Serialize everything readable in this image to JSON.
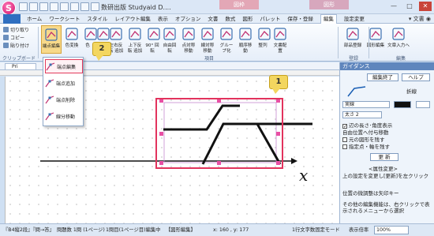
{
  "window": {
    "title": "数研出版 Studyaid D....",
    "context_tab_zoom": "図枠",
    "context_tab_figure": "図形",
    "app_icon": "S"
  },
  "menu": {
    "file": "",
    "items": [
      "ホーム",
      "ワークシート",
      "スタイル",
      "レイアウト編集",
      "表示",
      "オプション",
      "文書",
      "数式",
      "図形",
      "パレット",
      "保存・登録",
      "編集",
      "設定変更"
    ],
    "active_index": 11,
    "user": "文書"
  },
  "ribbon": {
    "clipboard": {
      "cut": "切り取り",
      "copy": "コピー",
      "paste": "貼り付け",
      "label": "クリップボード"
    },
    "buttons": [
      {
        "label": "端点編集",
        "selected": true
      },
      {
        "label": "色変換"
      },
      {
        "label": "色"
      },
      {
        "label": "縮小"
      },
      {
        "label": "左右反転 追加"
      },
      {
        "label": "上下反転 追加"
      },
      {
        "label": "90° 回転"
      },
      {
        "label": "自由回転"
      },
      {
        "label": "点対称 移動"
      },
      {
        "label": "線対称 移動"
      },
      {
        "label": "グループ化"
      },
      {
        "label": "順序移動"
      },
      {
        "label": "整列"
      },
      {
        "label": "文書配置"
      },
      {
        "label": "部品登録"
      },
      {
        "label": "図形編集"
      },
      {
        "label": "文章入力へ"
      }
    ],
    "group_edit": "項目",
    "group_register": "登録",
    "group_edit2": "編集"
  },
  "dropdown": {
    "items": [
      "端点編集",
      "端点追加",
      "端点削除",
      "線分移動"
    ],
    "highlighted_index": 0
  },
  "doc_tab": "Pri",
  "callouts": {
    "c1": "1",
    "c2": "2"
  },
  "canvas": {
    "x_axis_label": "x"
  },
  "guidance": {
    "header": "ガイダンス",
    "end_edit": "編集終了",
    "help": "ヘルプ",
    "line_type_label": "折線",
    "line_style": "実線",
    "thickness": "太さ 2",
    "check_fix_length": "辺の長さ･角度表示",
    "free_point_move": "自由位置へ付与移動",
    "check_original": "元の図形を残す",
    "check_fixed_point": "指定点・軸を残す",
    "update": "更 新",
    "change_title": "<属性変更>",
    "change_desc": "上の設定を変更し[更新]を左クリック",
    "note1": "位置の微調整は矢印キー",
    "note2": "その他の編集機能は、右クリックで表示されるメニューから選択"
  },
  "status": {
    "s1": "『B4縦2段』『問→答』",
    "s2": "問題数  1問 (1ページ)",
    "s3": "1問目(1ページ目)編集中",
    "s4": "【図形編集】",
    "coords": "x: 160 , y: 177",
    "s5": "1行文字数固定モード",
    "zoom_label": "表示倍率",
    "zoom": "100%"
  }
}
